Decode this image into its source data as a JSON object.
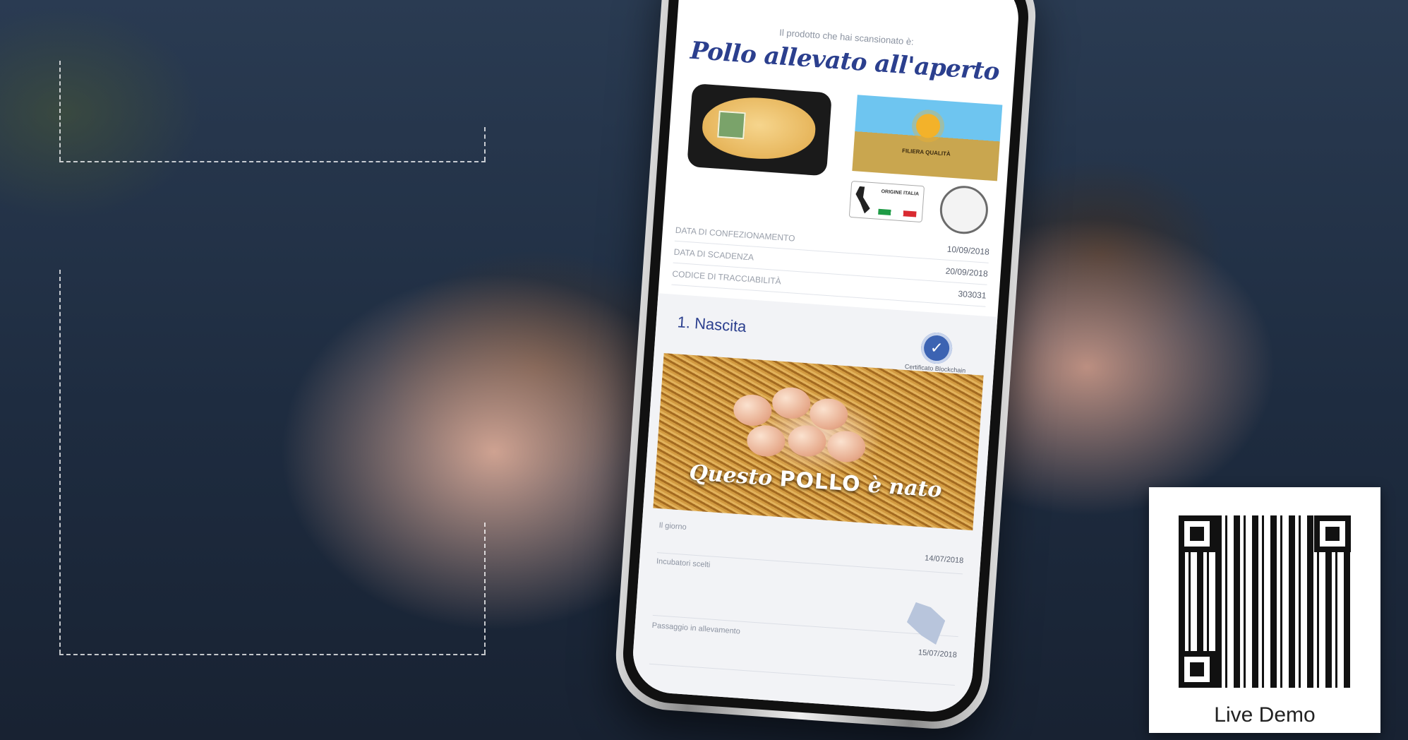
{
  "phone": {
    "scan_note": "Il prodotto che hai scansionato è:",
    "product_title": "Pollo allevato all'aperto",
    "brand_logo_text": "FILIERA QUALITÀ",
    "origin_badge_text": "ORIGINE ITALIA",
    "packaging_rows": [
      {
        "key": "DATA DI CONFEZIONAMENTO",
        "value": "10/09/2018"
      },
      {
        "key": "DATA DI SCADENZA",
        "value": "20/09/2018"
      },
      {
        "key": "CODICE DI TRACCIABILITÀ",
        "value": "303031"
      }
    ],
    "section": {
      "title": "1. Nascita",
      "certificate_label": "Certificato Blockchain",
      "certificate_icon": "checkmark-badge-icon",
      "photo_caption_pre": "Questo",
      "photo_caption_bold": "POLLO",
      "photo_caption_post": "è nato",
      "birth_rows": [
        {
          "key": "Il giorno",
          "value": "14/07/2018"
        },
        {
          "key": "Incubatori scelti",
          "value": ""
        },
        {
          "key": "Passaggio in allevamento",
          "value": "15/07/2018"
        }
      ]
    }
  },
  "qr": {
    "label": "Live Demo"
  },
  "colors": {
    "title_blue": "#2b3f8e",
    "background": "#1d2a3b"
  }
}
